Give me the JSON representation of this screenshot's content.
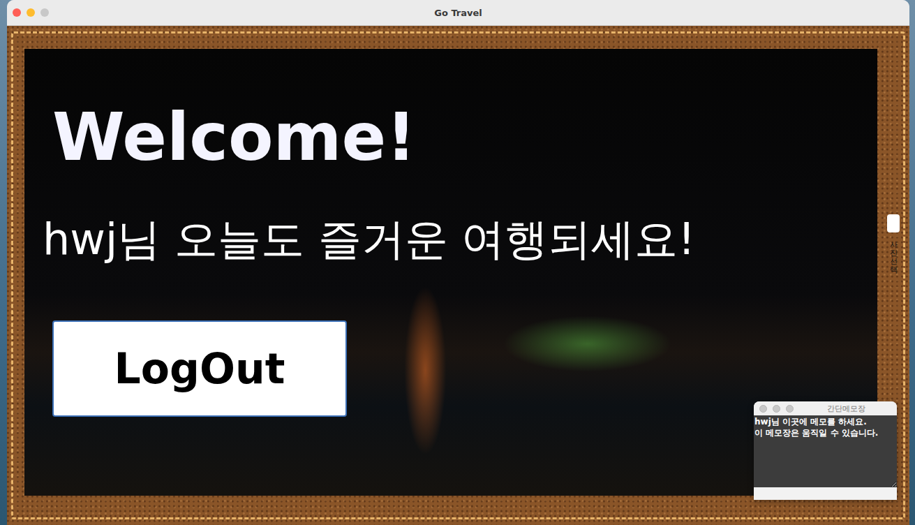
{
  "window": {
    "title": "Go Travel",
    "controls": [
      {
        "kind": "close",
        "color": "#ff5f57"
      },
      {
        "kind": "minimize",
        "color": "#febc2e"
      },
      {
        "kind": "zoom",
        "color": "#c8c8c8"
      }
    ]
  },
  "welcome": {
    "heading": "Welcome!",
    "greeting": "hwj님 오늘도 즐거운 여행되세요!"
  },
  "logout_button": {
    "label": "LogOut"
  },
  "side_button": {
    "label": "사진 선택"
  },
  "memo": {
    "title": "간단메모장",
    "text": "hwj님 이곳에 메모를 하세요.\n이 메모장은 움직일 수 있습니다.",
    "controls": [
      {
        "kind": "close",
        "color": "#c8c8c8"
      },
      {
        "kind": "minimize",
        "color": "#c8c8c8"
      },
      {
        "kind": "zoom",
        "color": "#c8c8c8"
      }
    ]
  }
}
